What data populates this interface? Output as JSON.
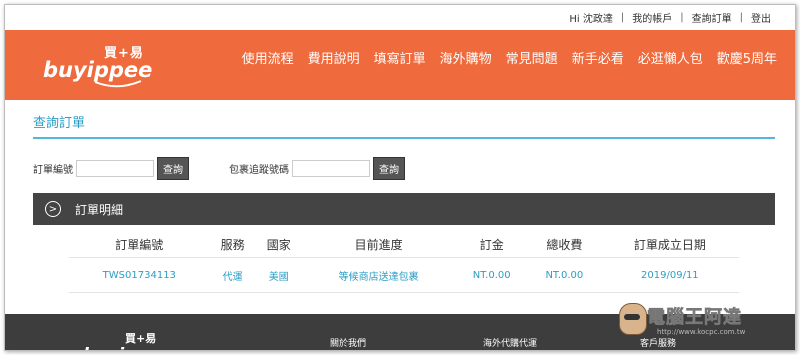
{
  "topbar": {
    "greeting": "Hi 沈政達",
    "sep": "|",
    "links": [
      "我的帳戶",
      "查詢訂單",
      "登出"
    ]
  },
  "logo": {
    "cn": "買+易",
    "en": "buyippee"
  },
  "nav": [
    "使用流程",
    "費用說明",
    "填寫訂單",
    "海外購物",
    "常見問題",
    "新手必看",
    "必逛懶人包",
    "歡慶5周年"
  ],
  "page_title": "查詢訂單",
  "search": {
    "order_label": "訂單編號",
    "order_button": "查詢",
    "tracking_label": "包裹追蹤號碼",
    "tracking_button": "查詢"
  },
  "details": {
    "icon_glyph": ">",
    "title": "訂單明細"
  },
  "table": {
    "headers": [
      "訂單編號",
      "服務",
      "國家",
      "目前進度",
      "訂金",
      "總收費",
      "訂單成立日期"
    ],
    "rows": [
      [
        "TWS01734113",
        "代運",
        "美國",
        "等候商店送達包裹",
        "NT.0.00",
        "NT.0.00",
        "2019/09/11"
      ]
    ]
  },
  "footer": {
    "logo_cn": "買+易",
    "logo_en": "buyippee",
    "links": [
      "關於我們",
      "海外代購代運",
      "客戶服務"
    ]
  },
  "watermark": {
    "title": "電腦王阿達",
    "url": "http://www.kocpc.com.tw"
  },
  "colors": {
    "brand_orange": "#ef6a3c",
    "accent_blue": "#2b9ec5",
    "dark_bar": "#444444",
    "footer": "#3d3d3d"
  }
}
